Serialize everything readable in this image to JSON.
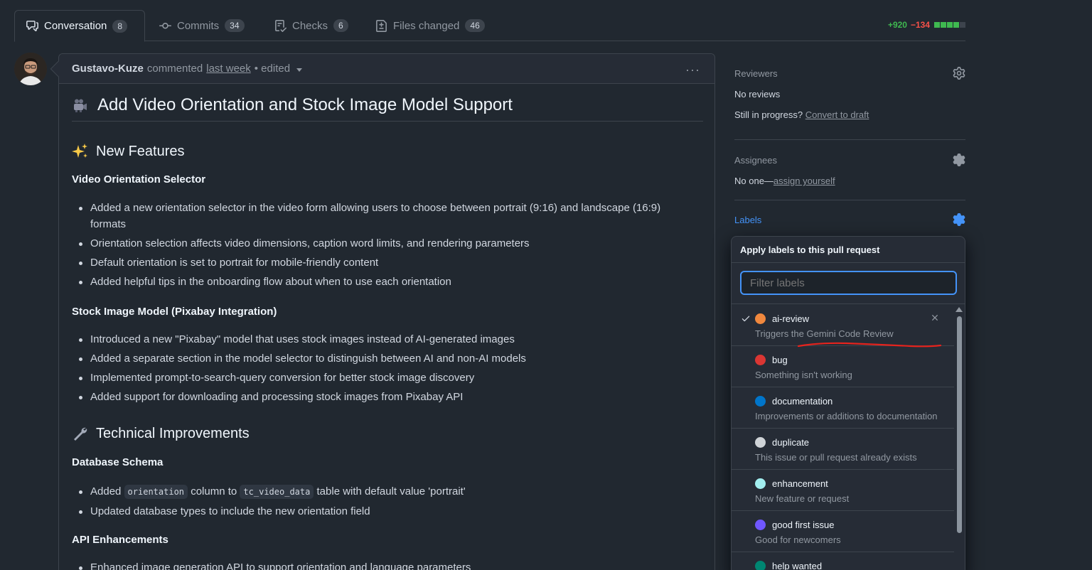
{
  "tabs": [
    {
      "label": "Conversation",
      "count": "8"
    },
    {
      "label": "Commits",
      "count": "34"
    },
    {
      "label": "Checks",
      "count": "6"
    },
    {
      "label": "Files changed",
      "count": "46"
    }
  ],
  "diffstat": {
    "additions": "+920",
    "deletions": "−134"
  },
  "comment": {
    "author": "Gustavo-Kuze",
    "action": "commented",
    "time": "last week",
    "edited": "• edited"
  },
  "content": {
    "title": "Add Video Orientation and Stock Image Model Support",
    "new_features": "New Features",
    "video_orientation_heading": "Video Orientation Selector",
    "video_orientation_items": [
      "Added a new orientation selector in the video form allowing users to choose between portrait (9:16) and landscape (16:9) formats",
      "Orientation selection affects video dimensions, caption word limits, and rendering parameters",
      "Default orientation is set to portrait for mobile-friendly content",
      "Added helpful tips in the onboarding flow about when to use each orientation"
    ],
    "stock_heading": "Stock Image Model (Pixabay Integration)",
    "stock_items": [
      "Introduced a new \"Pixabay\" model that uses stock images instead of AI-generated images",
      "Added a separate section in the model selector to distinguish between AI and non-AI models",
      "Implemented prompt-to-search-query conversion for better stock image discovery",
      "Added support for downloading and processing stock images from Pixabay API"
    ],
    "tech_improvements": "Technical Improvements",
    "db_heading": "Database Schema",
    "db_item1_pre": "Added",
    "db_item1_code1": "orientation",
    "db_item1_mid": "column to",
    "db_item1_code2": "tc_video_data",
    "db_item1_post": "table with default value 'portrait'",
    "db_item2": "Updated database types to include the new orientation field",
    "api_heading": "API Enhancements",
    "api_item1": "Enhanced image generation API to support orientation and language parameters"
  },
  "sidebar": {
    "reviewers_title": "Reviewers",
    "reviewers_value": "No reviews",
    "in_progress": "Still in progress?",
    "convert_draft": "Convert to draft",
    "assignees_title": "Assignees",
    "assignees_value": "No one—",
    "assign_yourself": "assign yourself",
    "labels_title": "Labels"
  },
  "labels_dropdown": {
    "header": "Apply labels to this pull request",
    "filter_placeholder": "Filter labels",
    "items": [
      {
        "name": "ai-review",
        "desc": "Triggers the Gemini Code Review",
        "color": "#f0883e",
        "selected": true
      },
      {
        "name": "bug",
        "desc": "Something isn't working",
        "color": "#da3633",
        "selected": false
      },
      {
        "name": "documentation",
        "desc": "Improvements or additions to documentation",
        "color": "#0075ca",
        "selected": false
      },
      {
        "name": "duplicate",
        "desc": "This issue or pull request already exists",
        "color": "#cfd3d7",
        "selected": false
      },
      {
        "name": "enhancement",
        "desc": "New feature or request",
        "color": "#a2eeef",
        "selected": false
      },
      {
        "name": "good first issue",
        "desc": "Good for newcomers",
        "color": "#7057ff",
        "selected": false
      },
      {
        "name": "help wanted",
        "desc": "",
        "color": "#008672",
        "selected": false
      }
    ]
  },
  "colors": {
    "accent": "#4493f8",
    "annotation": "#e5231d",
    "bg": "#212830"
  }
}
